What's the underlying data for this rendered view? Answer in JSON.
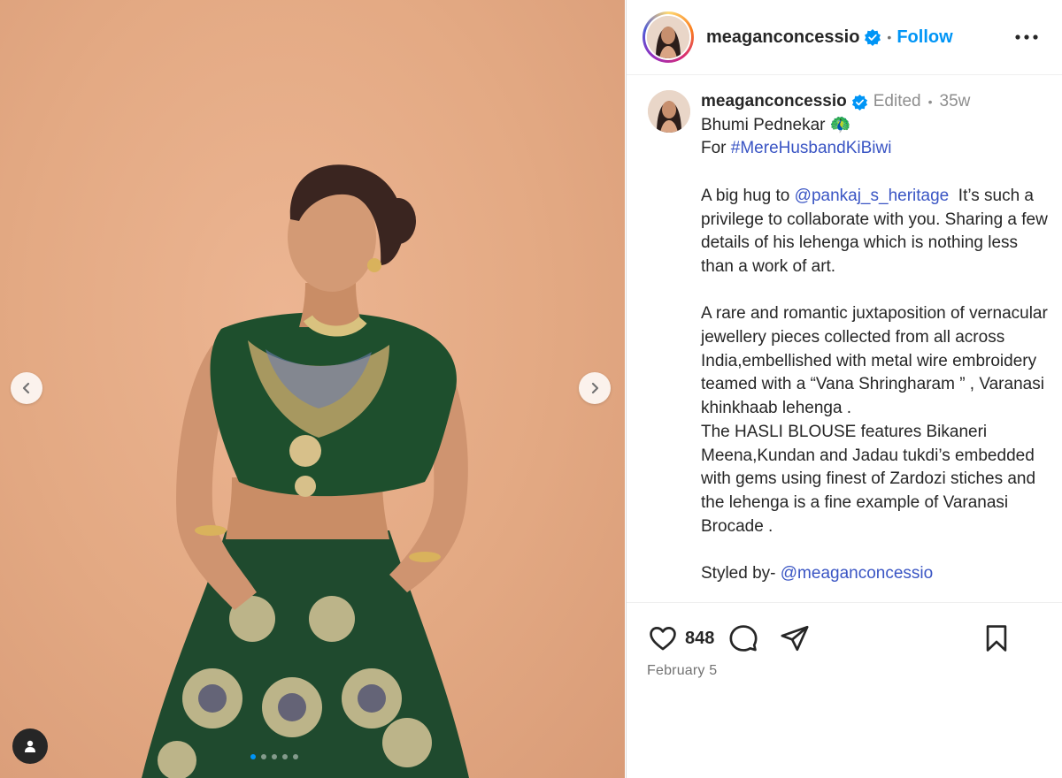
{
  "post": {
    "username": "meaganconcessio",
    "follow_label": "Follow",
    "separator": "•",
    "verified_color": "#0095f6",
    "caption": {
      "edited_label": "Edited",
      "time_ago": "35w",
      "line1": "Bhumi Pednekar 🦚",
      "line2_prefix": "For ",
      "hashtag": "#MereHusbandKiBiwi",
      "p2_prefix": "A big hug to ",
      "mention1": "@pankaj_s_heritage",
      "p2_rest": "  It’s such a privilege to collaborate with you. Sharing a few details of his lehenga which is nothing less than a work of art.",
      "p3": "A rare and romantic juxtaposition of vernacular jewellery pieces collected from all across India,embellished with metal wire embroidery teamed with a “Vana Shringharam ” , Varanasi khinkhaab lehenga .\nThe HASLI BLOUSE features Bikaneri Meena,Kundan and Jadau tukdi’s embedded with gems using finest of Zardozi stiches and the lehenga is a fine example of Varanasi Brocade .",
      "p4_prefix": "Styled by- ",
      "mention2": "@meaganconcessio"
    },
    "likes": "848",
    "date": "February 5"
  },
  "media": {
    "icons": {
      "prev": "chevron-left-icon",
      "next": "chevron-right-icon",
      "tags": "user-tag-icon"
    },
    "carousel_count": 5,
    "carousel_active": 0
  },
  "icons": {
    "more": "more-horizontal-icon",
    "like": "heart-icon",
    "comment": "comment-icon",
    "share": "send-icon",
    "save": "bookmark-icon"
  }
}
